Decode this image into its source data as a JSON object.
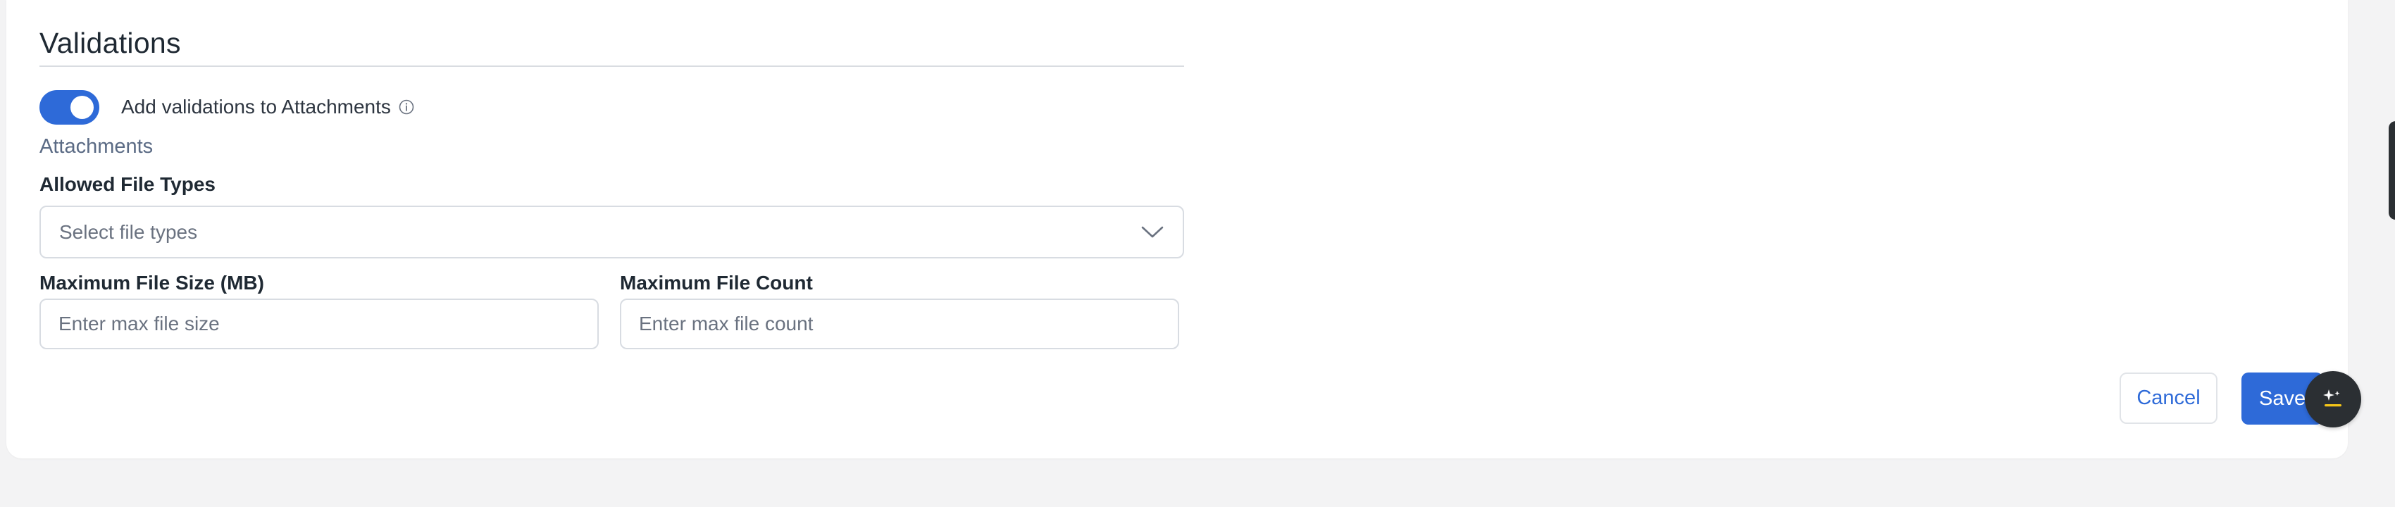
{
  "section": {
    "title": "Validations"
  },
  "toggle": {
    "label": "Add validations to Attachments",
    "enabled": true
  },
  "subsection": {
    "label": "Attachments"
  },
  "fields": {
    "file_types": {
      "label": "Allowed File Types",
      "placeholder": "Select file types"
    },
    "max_size": {
      "label": "Maximum File Size (MB)",
      "placeholder": "Enter max file size"
    },
    "max_count": {
      "label": "Maximum File Count",
      "placeholder": "Enter max file count"
    }
  },
  "actions": {
    "cancel_label": "Cancel",
    "save_label": "Save"
  },
  "icons": {
    "info": "info-icon",
    "chevron": "chevron-down-icon",
    "ai": "sparkle-icon"
  },
  "colors": {
    "accent": "#2e6ad8",
    "fab": "#2b2f33",
    "fab_accent": "#f5c518"
  }
}
